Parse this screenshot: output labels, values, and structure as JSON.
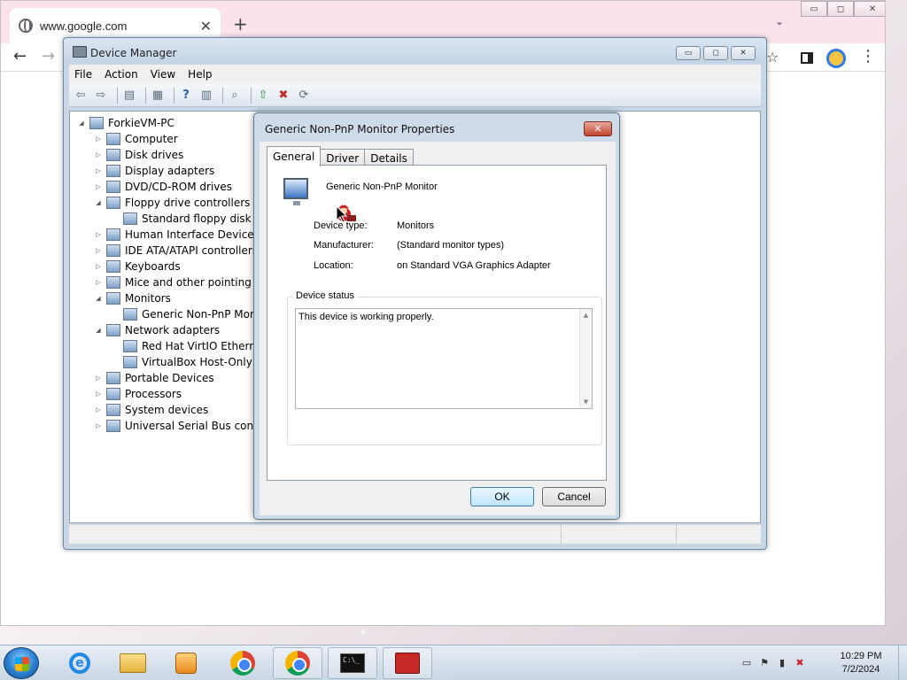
{
  "browser": {
    "tab_title": "www.google.com",
    "new_tab": "+",
    "tab_close": "✕",
    "chevron": "⌄",
    "window_buttons": [
      "▭",
      "◻",
      "✕"
    ],
    "back": "←",
    "forward": "→",
    "bookmark": "☆",
    "menu": "⋮"
  },
  "device_manager": {
    "title": "Device Manager",
    "window_buttons": [
      "▭",
      "◻",
      "✕"
    ],
    "menu": [
      "File",
      "Action",
      "View",
      "Help"
    ],
    "toolbar_icons": [
      "back-arrow-icon",
      "forward-arrow-icon",
      "properties-icon",
      "show-hidden-icon",
      "help-icon",
      "view-icon",
      "scan-icon",
      "update-driver-icon",
      "uninstall-icon",
      "enable-icon"
    ],
    "tree": [
      {
        "label": "ForkieVM-PC",
        "level": 0,
        "exp": "◢"
      },
      {
        "label": "Computer",
        "level": 1,
        "exp": "▷"
      },
      {
        "label": "Disk drives",
        "level": 1,
        "exp": "▷"
      },
      {
        "label": "Display adapters",
        "level": 1,
        "exp": "▷"
      },
      {
        "label": "DVD/CD-ROM drives",
        "level": 1,
        "exp": "▷"
      },
      {
        "label": "Floppy drive controllers",
        "level": 1,
        "exp": "◢"
      },
      {
        "label": "Standard floppy disk co",
        "level": 2,
        "exp": ""
      },
      {
        "label": "Human Interface Devices",
        "level": 1,
        "exp": "▷"
      },
      {
        "label": "IDE ATA/ATAPI controllers",
        "level": 1,
        "exp": "▷"
      },
      {
        "label": "Keyboards",
        "level": 1,
        "exp": "▷"
      },
      {
        "label": "Mice and other pointing de",
        "level": 1,
        "exp": "▷"
      },
      {
        "label": "Monitors",
        "level": 1,
        "exp": "◢"
      },
      {
        "label": "Generic Non-PnP Moni",
        "level": 2,
        "exp": ""
      },
      {
        "label": "Network adapters",
        "level": 1,
        "exp": "◢"
      },
      {
        "label": "Red Hat VirtIO Ethernet",
        "level": 2,
        "exp": ""
      },
      {
        "label": "VirtualBox Host-Only Et",
        "level": 2,
        "exp": ""
      },
      {
        "label": "Portable Devices",
        "level": 1,
        "exp": "▷"
      },
      {
        "label": "Processors",
        "level": 1,
        "exp": "▷"
      },
      {
        "label": "System devices",
        "level": 1,
        "exp": "▷"
      },
      {
        "label": "Universal Serial Bus control",
        "level": 1,
        "exp": "▷"
      }
    ]
  },
  "properties": {
    "title": "Generic Non-PnP Monitor Properties",
    "close": "✕",
    "tabs": [
      "General",
      "Driver",
      "Details"
    ],
    "device_name": "Generic Non-PnP Monitor",
    "device_type_label": "Device type:",
    "device_type_value": "Monitors",
    "manufacturer_label": "Manufacturer:",
    "manufacturer_value": "(Standard monitor types)",
    "location_label": "Location:",
    "location_value": "on Standard VGA Graphics Adapter",
    "status_legend": "Device status",
    "status_text": "This device is working properly.",
    "ok": "OK",
    "cancel": "Cancel"
  },
  "taskbar": {
    "clock_time": "10:29 PM",
    "clock_date": "7/2/2024",
    "cmd_text": "C:\\_"
  }
}
